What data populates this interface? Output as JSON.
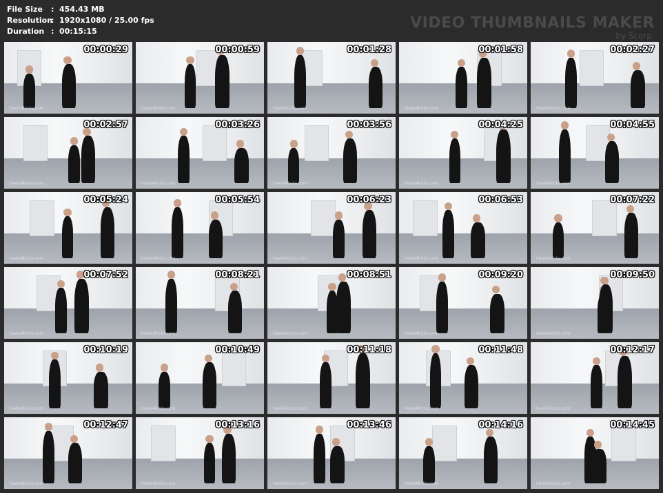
{
  "info": {
    "file_size_label": "File Size",
    "file_size_value": "454.43 MB",
    "resolution_label": "Resolution",
    "resolution_value": "1920x1080 / 25.00 fps",
    "duration_label": "Duration",
    "duration_value": "00:15:15",
    "separator": ":"
  },
  "brand": {
    "title": "VIDEO THUMBNAILS MAKER",
    "subtitle": "by Scorp"
  },
  "watermark": "heels4kicks.com",
  "thumbnails": [
    "00:00:29",
    "00:00:59",
    "00:01:28",
    "00:01:58",
    "00:02:27",
    "00:02:57",
    "00:03:26",
    "00:03:56",
    "00:04:25",
    "00:04:55",
    "00:05:24",
    "00:05:54",
    "00:06:23",
    "00:06:53",
    "00:07:22",
    "00:07:52",
    "00:08:21",
    "00:08:51",
    "00:09:20",
    "00:09:50",
    "00:10:19",
    "00:10:49",
    "00:11:18",
    "00:11:48",
    "00:12:17",
    "00:12:47",
    "00:13:16",
    "00:13:46",
    "00:14:16",
    "00:14:45"
  ]
}
